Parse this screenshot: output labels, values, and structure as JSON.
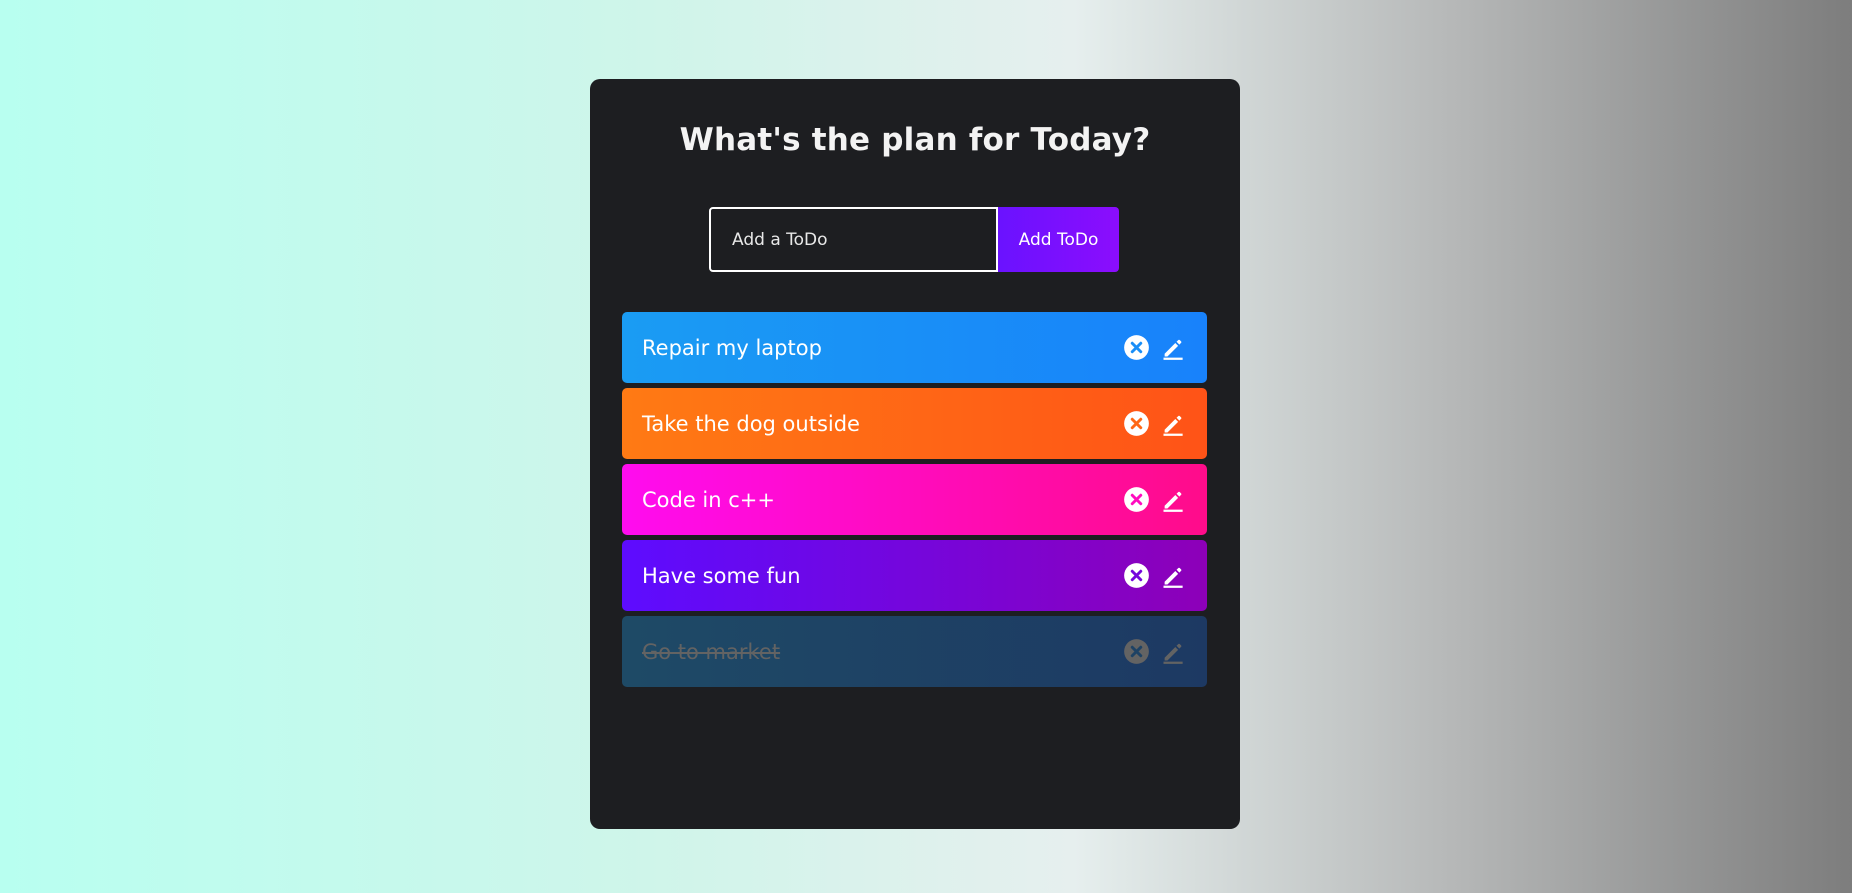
{
  "title": "What's the plan for Today?",
  "form": {
    "placeholder": "Add a ToDo",
    "value": "",
    "button_label": "Add ToDo"
  },
  "todos": [
    {
      "text": "Repair my laptop",
      "completed": false,
      "color": "#1a8ef7"
    },
    {
      "text": "Take the dog outside",
      "completed": false,
      "color": "#ff6816"
    },
    {
      "text": "Code in c++",
      "completed": false,
      "color": "#ff0cbf"
    },
    {
      "text": "Have some fun",
      "completed": false,
      "color": "#7506dc"
    },
    {
      "text": "Go to market",
      "completed": true,
      "color": "#1e4264"
    }
  ],
  "icons": {
    "delete": "close-circle-icon",
    "edit": "edit-pencil-icon"
  },
  "colors": {
    "card_background": "#1d1e21",
    "button_accent": "#7a0ffe",
    "completed_text": "#636363"
  }
}
